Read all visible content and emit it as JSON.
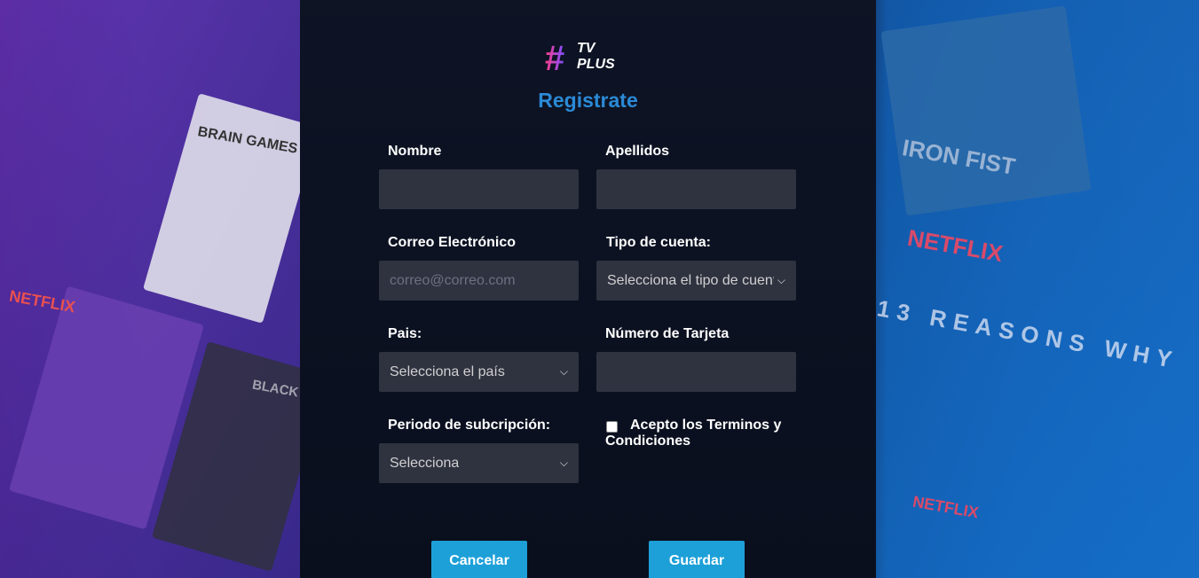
{
  "brand": {
    "logo_tv": "TV",
    "logo_plus": "PLUS",
    "hash": "#"
  },
  "form": {
    "title": "Registrate",
    "nombre_label": "Nombre",
    "apellidos_label": "Apellidos",
    "correo_label": "Correo Electrónico",
    "correo_placeholder": "correo@correo.com",
    "tipo_cuenta_label": "Tipo de cuenta:",
    "tipo_cuenta_value": "Selecciona el tipo de cuenta",
    "pais_label": "Pais:",
    "pais_value": "Selecciona el país",
    "tarjeta_label": "Número de Tarjeta",
    "periodo_label": "Periodo de subcripción:",
    "periodo_value": "Selecciona",
    "terminos_label": "Acepto los Terminos y Condiciones",
    "terminos_checked": false,
    "cancel_label": "Cancelar",
    "save_label": "Guardar"
  },
  "background": {
    "left_posters": [
      "BRAIN GAMES",
      "NETFLIX",
      "BLACK"
    ],
    "right_posters": [
      "IRON FIST",
      "NETFLIX",
      "13 REASONS WHY",
      "NETFLIX"
    ]
  },
  "colors": {
    "accent": "#1da0d8",
    "title": "#2b8ad6",
    "panel": "#0a0f1e",
    "field": "#2f3340"
  }
}
